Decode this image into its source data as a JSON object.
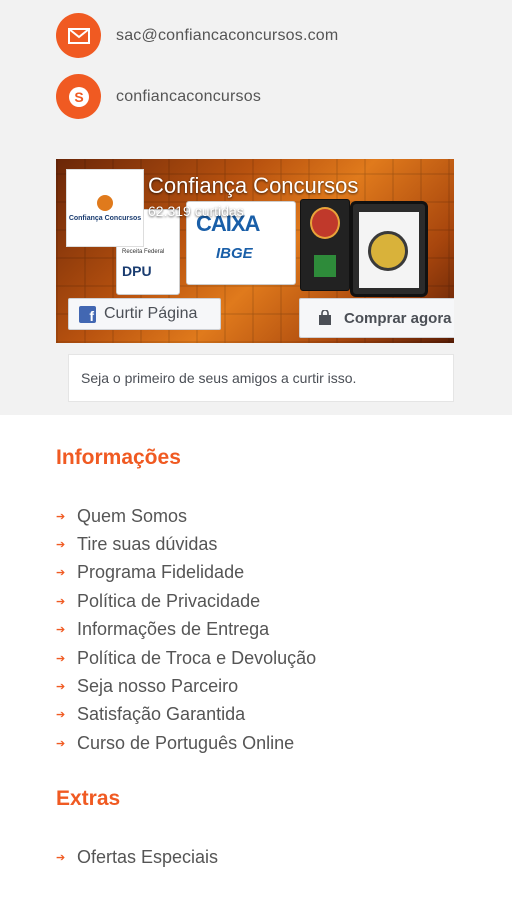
{
  "contact": {
    "email": {
      "icon": "mail-icon",
      "text": "sac@confiancaconcursos.com"
    },
    "skype": {
      "icon": "skype-icon",
      "text": "confiancaconcursos"
    }
  },
  "facebook_widget": {
    "page_name": "Confiança Concursos",
    "likes": "62.319 curtidas",
    "like_button": "Curtir Página",
    "shop_button": "Comprar agora",
    "friends_text": "Seja o primeiro de seus amigos a curtir isso.",
    "logo_text": "Confiança Concursos",
    "cover_texts": {
      "caixa": "CAIXA",
      "ibge": "IBGE",
      "dpu": "DPU",
      "receita": "Receita Federal"
    }
  },
  "informacoes": {
    "title": "Informações",
    "items": [
      "Quem Somos",
      "Tire suas dúvidas",
      "Programa Fidelidade",
      "Política de Privacidade",
      "Informações de Entrega",
      "Política de Troca e Devolução",
      "Seja nosso Parceiro",
      "Satisfação Garantida",
      "Curso de Português Online"
    ]
  },
  "extras": {
    "title": "Extras",
    "items": [
      "Ofertas Especiais"
    ]
  },
  "colors": {
    "accent": "#f05a22",
    "facebook_blue": "#4267b2"
  }
}
